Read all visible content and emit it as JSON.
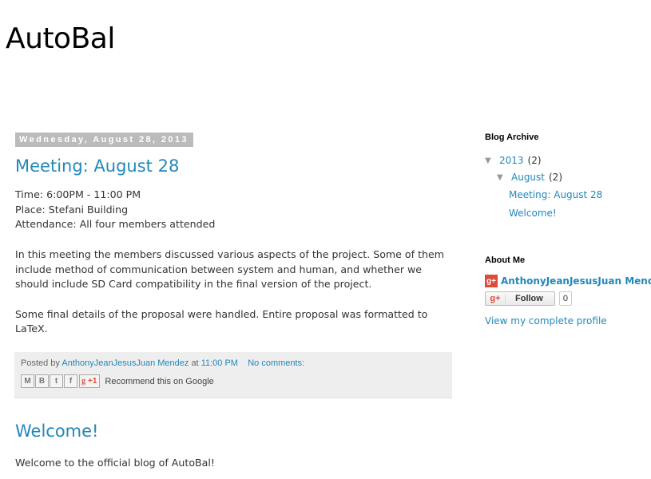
{
  "blog": {
    "title": "AutoBal"
  },
  "posts": [
    {
      "date": "Wednesday, August 28, 2013",
      "title": "Meeting: August 28",
      "lines": [
        "Time: 6:00PM - 11:00 PM",
        "Place: Stefani Building",
        "Attendance: All four members attended"
      ],
      "para1": "In this meeting the members discussed various aspects of the project. Some of them include method of communication between system and human, and whether we should include SD Card compatibility in the final version of the project.",
      "para2": "Some final details of the proposal were handled. Entire proposal was formatted to LaTeX.",
      "footer": {
        "posted_by": "Posted by",
        "author": "AnthonyJeanJesusJuan Mendez",
        "at": "at",
        "time": "11:00 PM",
        "comments": "No comments:",
        "share_icons": [
          "email-icon",
          "blogger-icon",
          "twitter-icon",
          "facebook-icon"
        ],
        "share_glyphs": [
          "M",
          "B",
          "t",
          "f"
        ],
        "plusone_label": "+1",
        "recommend": "Recommend this on Google"
      }
    },
    {
      "title": "Welcome!",
      "body": "Welcome to the official blog of AutoBal!"
    }
  ],
  "sidebar": {
    "archive": {
      "title": "Blog Archive",
      "year": "2013",
      "year_count": "(2)",
      "month": "August",
      "month_count": "(2)",
      "posts": [
        "Meeting: August 28",
        "Welcome!"
      ]
    },
    "about": {
      "title": "About Me",
      "name": "AnthonyJeanJesusJuan Mendez",
      "gplus_glyph": "g+",
      "follow_label": "Follow",
      "follow_count": "0",
      "profile_link": "View my complete profile"
    }
  }
}
